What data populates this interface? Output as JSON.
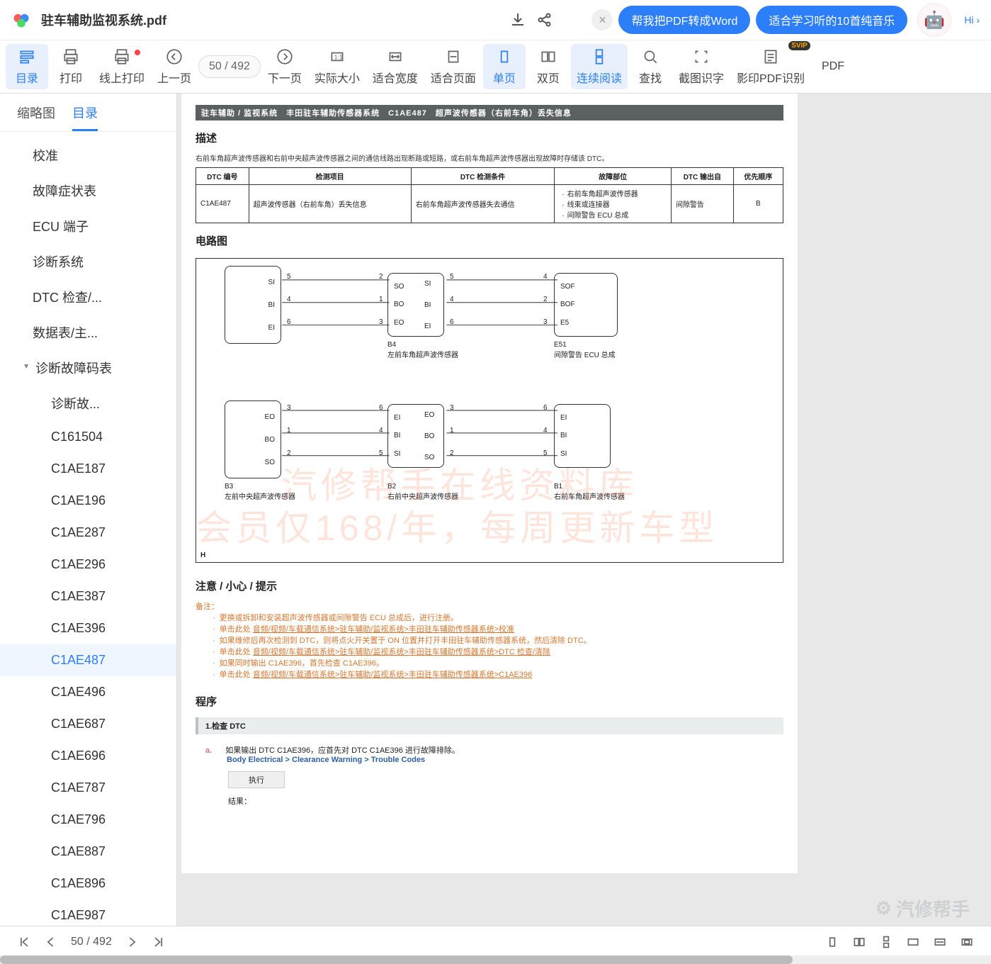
{
  "titlebar": {
    "doc_title": "驻车辅助监视系统.pdf",
    "hi": "Hi ›",
    "pill1": "帮我把PDF转成Word",
    "pill2": "适合学习听的10首纯音乐"
  },
  "toolbar": {
    "items": [
      {
        "label": "目录",
        "active": true
      },
      {
        "label": "打印"
      },
      {
        "label": "线上打印",
        "reddot": true
      },
      {
        "label": "上一页"
      },
      {
        "label": "__page__"
      },
      {
        "label": "下一页"
      },
      {
        "label": "实际大小"
      },
      {
        "label": "适合宽度"
      },
      {
        "label": "适合页面"
      },
      {
        "label": "单页",
        "active": true
      },
      {
        "label": "双页"
      },
      {
        "label": "连续阅读",
        "active": true
      },
      {
        "label": "查找"
      },
      {
        "label": "截图识字"
      },
      {
        "label": "影印PDF识别",
        "svip": true
      },
      {
        "label": "PDF"
      }
    ],
    "page_current": "50",
    "page_sep": " / ",
    "page_total": "492"
  },
  "side_tabs": {
    "thumb": "缩略图",
    "toc": "目录"
  },
  "toc": [
    {
      "t": "校准",
      "lv": 1
    },
    {
      "t": "故障症状表",
      "lv": 1
    },
    {
      "t": "ECU 端子",
      "lv": 1
    },
    {
      "t": "诊断系统",
      "lv": 1
    },
    {
      "t": "DTC 检查/...",
      "lv": 1
    },
    {
      "t": "数据表/主...",
      "lv": 1
    },
    {
      "t": "诊断故障码表",
      "lv": 1,
      "exp": true
    },
    {
      "t": "诊断故...",
      "lv": 2
    },
    {
      "t": "C161504",
      "lv": 2
    },
    {
      "t": "C1AE187",
      "lv": 2
    },
    {
      "t": "C1AE196",
      "lv": 2
    },
    {
      "t": "C1AE287",
      "lv": 2
    },
    {
      "t": "C1AE296",
      "lv": 2
    },
    {
      "t": "C1AE387",
      "lv": 2
    },
    {
      "t": "C1AE396",
      "lv": 2
    },
    {
      "t": "C1AE487",
      "lv": 2,
      "sel": true
    },
    {
      "t": "C1AE496",
      "lv": 2
    },
    {
      "t": "C1AE687",
      "lv": 2
    },
    {
      "t": "C1AE696",
      "lv": 2
    },
    {
      "t": "C1AE787",
      "lv": 2
    },
    {
      "t": "C1AE796",
      "lv": 2
    },
    {
      "t": "C1AE887",
      "lv": 2
    },
    {
      "t": "C1AE896",
      "lv": 2
    },
    {
      "t": "C1AE987",
      "lv": 2
    }
  ],
  "page": {
    "blackbar": "驻车辅助 / 监视系统　丰田驻车辅助传感器系统　C1AE487　超声波传感器（右前车角）丢失信息",
    "h_desc": "描述",
    "desc_text": "右前车角超声波传感器和右前中央超声波传感器之间的通信线路出现断路或短路，或右前车角超声波传感器出现故障时存储该 DTC。",
    "table": {
      "headers": [
        "DTC 编号",
        "检测项目",
        "DTC 检测条件",
        "故障部位",
        "DTC 输出自",
        "优先顺序"
      ],
      "code": "C1AE487",
      "item": "超声波传感器（右前车角）丢失信息",
      "cond": "右前车角超声波传感器失去通信",
      "faults": [
        "右前车角超声波传感器",
        "线束或连接器",
        "间隙警告 ECU 总成"
      ],
      "output": "间隙警告",
      "prio": "B"
    },
    "h_circuit": "电路图",
    "sensor_labels": {
      "b4": "B4",
      "b4_name": "左前车角超声波传感器",
      "e51": "E51",
      "e51_name": "间隙警告 ECU 总成",
      "b3": "B3",
      "b3_name": "左前中央超声波传感器",
      "b2": "B2",
      "b2_name": "右前中央超声波传感器",
      "b1": "B1",
      "b1_name": "右前车角超声波传感器",
      "pins_top": [
        "SI",
        "BI",
        "EI"
      ],
      "pins_mid": [
        "SO",
        "BO",
        "EO"
      ],
      "pins_mid2": [
        "SI",
        "BI",
        "EI"
      ],
      "pins_e51": [
        "SOF",
        "BOF",
        "E5"
      ],
      "pins_bot": [
        "EO",
        "BO",
        "SO"
      ],
      "pins_bot_io": [
        "EI",
        "BI",
        "SI"
      ],
      "H": "H"
    },
    "watermark1": "汽修帮手在线资料库",
    "watermark2": "会员仅168/年，每周更新车型",
    "h_note": "注意 / 小心 / 提示",
    "note_label": "备注：",
    "notes": [
      "更换或拆卸和安装超声波传感器或间隙警告 ECU 总成后，进行注册。",
      "单击此处 音频/视频/车载通信系统>驻车辅助/监视系统>丰田驻车辅助传感器系统>校准",
      "如果维修后再次检测到 DTC，则将点火开关置于 ON 位置并打开丰田驻车辅助传感器系统，然后清除 DTC。",
      "单击此处 音频/视频/车载通信系统>驻车辅助/监视系统>丰田驻车辅助传感器系统>DTC 检查/清除",
      "如果同时输出 C1AE396，首先检查 C1AE396。",
      "单击此处 音频/视频/车载通信系统>驻车辅助/监视系统>丰田驻车辅助传感器系统>C1AE396"
    ],
    "h_proc": "程序",
    "step1": "1.检查 DTC",
    "step_a_label": "a.",
    "step_a": "如果输出 DTC C1AE396，应首先对 DTC C1AE396 进行故障排除。",
    "blue": "Body Electrical > Clearance Warning > Trouble Codes",
    "exec": "执行",
    "result": "结果："
  },
  "bottom": {
    "page_cur": "50",
    "page_sep": " / ",
    "page_tot": "492"
  },
  "brand": "汽修帮手"
}
